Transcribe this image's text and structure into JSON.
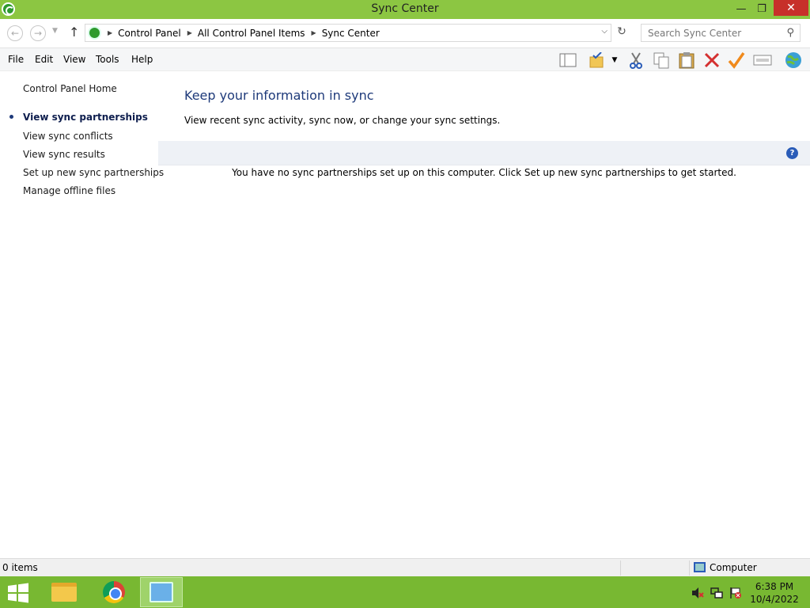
{
  "window": {
    "title": "Sync Center",
    "minimize_glyph": "—",
    "maximize_glyph": "❐",
    "close_glyph": "✕"
  },
  "address": {
    "crumbs": [
      "Control Panel",
      "All Control Panel Items",
      "Sync Center"
    ],
    "search_placeholder": "Search Sync Center"
  },
  "menu": {
    "items": [
      "File",
      "Edit",
      "View",
      "Tools",
      "Help"
    ]
  },
  "toolbar": {
    "icons": [
      "layout-pane-icon",
      "properties-icon",
      "cut-icon",
      "copy-icon",
      "paste-icon",
      "delete-icon",
      "check-icon",
      "rename-icon",
      "globe-icon"
    ]
  },
  "left_pane": {
    "home_link": "Control Panel Home",
    "tasks": [
      {
        "label": "View sync partnerships",
        "active": true
      },
      {
        "label": "View sync conflicts",
        "active": false
      },
      {
        "label": "View sync results",
        "active": false
      },
      {
        "label": "Set up new sync partnerships",
        "active": false
      },
      {
        "label": "Manage offline files",
        "active": false
      }
    ]
  },
  "main": {
    "title": "Keep your information in sync",
    "description": "View recent sync activity, sync now, or change your sync settings.",
    "empty_message": "You have no sync partnerships set up on this computer. Click Set up new sync partnerships to get started.",
    "help_glyph": "?"
  },
  "status": {
    "items": "0 items",
    "location": "Computer"
  },
  "taskbar": {
    "time": "6:38 PM",
    "date": "10/4/2022"
  },
  "colors": {
    "title_bar": "#8cc642",
    "taskbar": "#78b832",
    "link_blue": "#1e3a7a",
    "close_red": "#c7302a"
  }
}
